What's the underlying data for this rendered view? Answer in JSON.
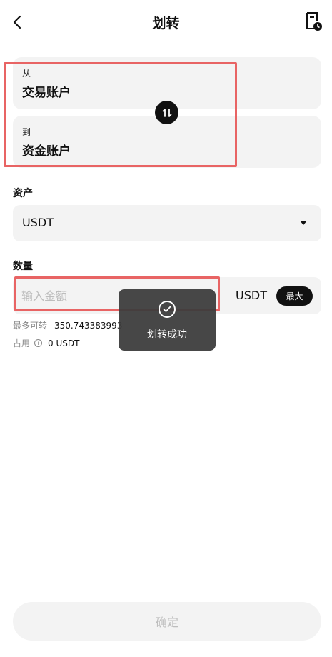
{
  "header": {
    "title": "划转",
    "back_icon": "chevron-left-icon",
    "record_icon": "document-clock-icon"
  },
  "transfer": {
    "from_label": "从",
    "from_account": "交易账户",
    "to_label": "到",
    "to_account": "资金账户",
    "swap_icon": "swap-arrows-icon"
  },
  "asset": {
    "label": "资产",
    "selected": "USDT"
  },
  "quantity": {
    "label": "数量",
    "placeholder": "输入金额",
    "value": "",
    "unit": "USDT",
    "max_label": "最大"
  },
  "info": {
    "max_transfer_label": "最多可转",
    "max_transfer_value": "350.743383993",
    "used_label": "占用",
    "used_value": "0 USDT"
  },
  "confirm_label": "确定",
  "toast": {
    "text": "划转成功",
    "icon": "check-circle-icon"
  },
  "colors": {
    "accent": "#111111",
    "card_bg": "#f3f3f3",
    "highlight": "#e86464",
    "toast_bg": "#3c3c3c"
  }
}
